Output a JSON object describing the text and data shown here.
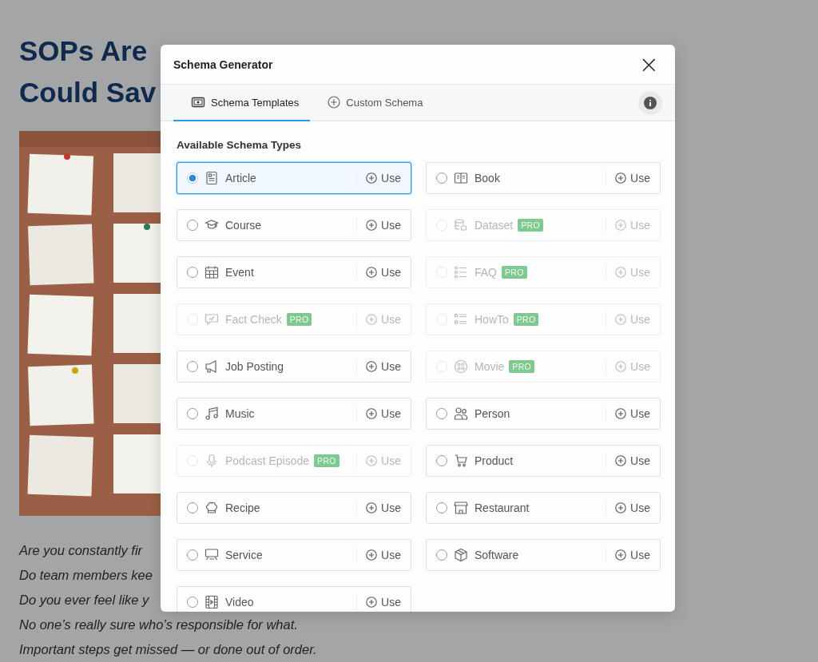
{
  "article": {
    "title_lines": [
      [
        "SOPs Are"
      ],
      [
        "Could Sav"
      ]
    ],
    "picture": {
      "kind": "picture"
    },
    "lines": [
      "Are you constantly fir",
      "Do team members kee",
      "Do you ever feel like y",
      "No one’s really sure who’s responsible for what.",
      "Important steps get missed — or done out of order."
    ]
  },
  "dialog": {
    "title": "Schema Generator",
    "close": "×",
    "tabs": [
      {
        "label": "Schema Templates",
        "selected": true
      },
      {
        "label": "Custom Schema",
        "selected": false
      }
    ],
    "section_title": "Available Schema Types",
    "schema_types": [
      {
        "name": "Article",
        "selected": true,
        "disabled": false,
        "action": "Use"
      },
      {
        "name": "Book",
        "selected": false,
        "disabled": false,
        "action": "Use"
      },
      {
        "name": "Course",
        "selected": false,
        "disabled": false,
        "action": "Use"
      },
      {
        "name": "Dataset",
        "selected": false,
        "disabled": true,
        "badge": "PRO",
        "action": "Use"
      },
      {
        "name": "Event",
        "selected": false,
        "disabled": false,
        "action": "Use"
      },
      {
        "name": "FAQ",
        "selected": false,
        "disabled": true,
        "badge": "PRO",
        "action": "Use"
      },
      {
        "name": "Fact Check",
        "selected": false,
        "disabled": true,
        "badge": "PRO",
        "action": "Use"
      },
      {
        "name": "HowTo",
        "selected": false,
        "disabled": true,
        "badge": "PRO",
        "action": "Use"
      },
      {
        "name": "Job Posting",
        "selected": false,
        "disabled": false,
        "action": "Use"
      },
      {
        "name": "Movie",
        "selected": false,
        "disabled": true,
        "badge": "PRO",
        "action": "Use"
      },
      {
        "name": "Music",
        "selected": false,
        "disabled": false,
        "action": "Use"
      },
      {
        "name": "Person",
        "selected": false,
        "disabled": false,
        "action": "Use"
      },
      {
        "name": "Podcast Episode",
        "selected": false,
        "disabled": true,
        "badge": "PRO",
        "action": "Use"
      },
      {
        "name": "Product",
        "selected": false,
        "disabled": false,
        "action": "Use"
      },
      {
        "name": "Recipe",
        "selected": false,
        "disabled": false,
        "action": "Use"
      },
      {
        "name": "Restaurant",
        "selected": false,
        "disabled": false,
        "action": "Use"
      },
      {
        "name": "Service",
        "selected": false,
        "disabled": false,
        "action": "Use"
      },
      {
        "name": "Software",
        "selected": false,
        "disabled": false,
        "action": "Use"
      },
      {
        "name": "Video",
        "selected": false,
        "disabled": false,
        "action": "Use"
      }
    ]
  }
}
